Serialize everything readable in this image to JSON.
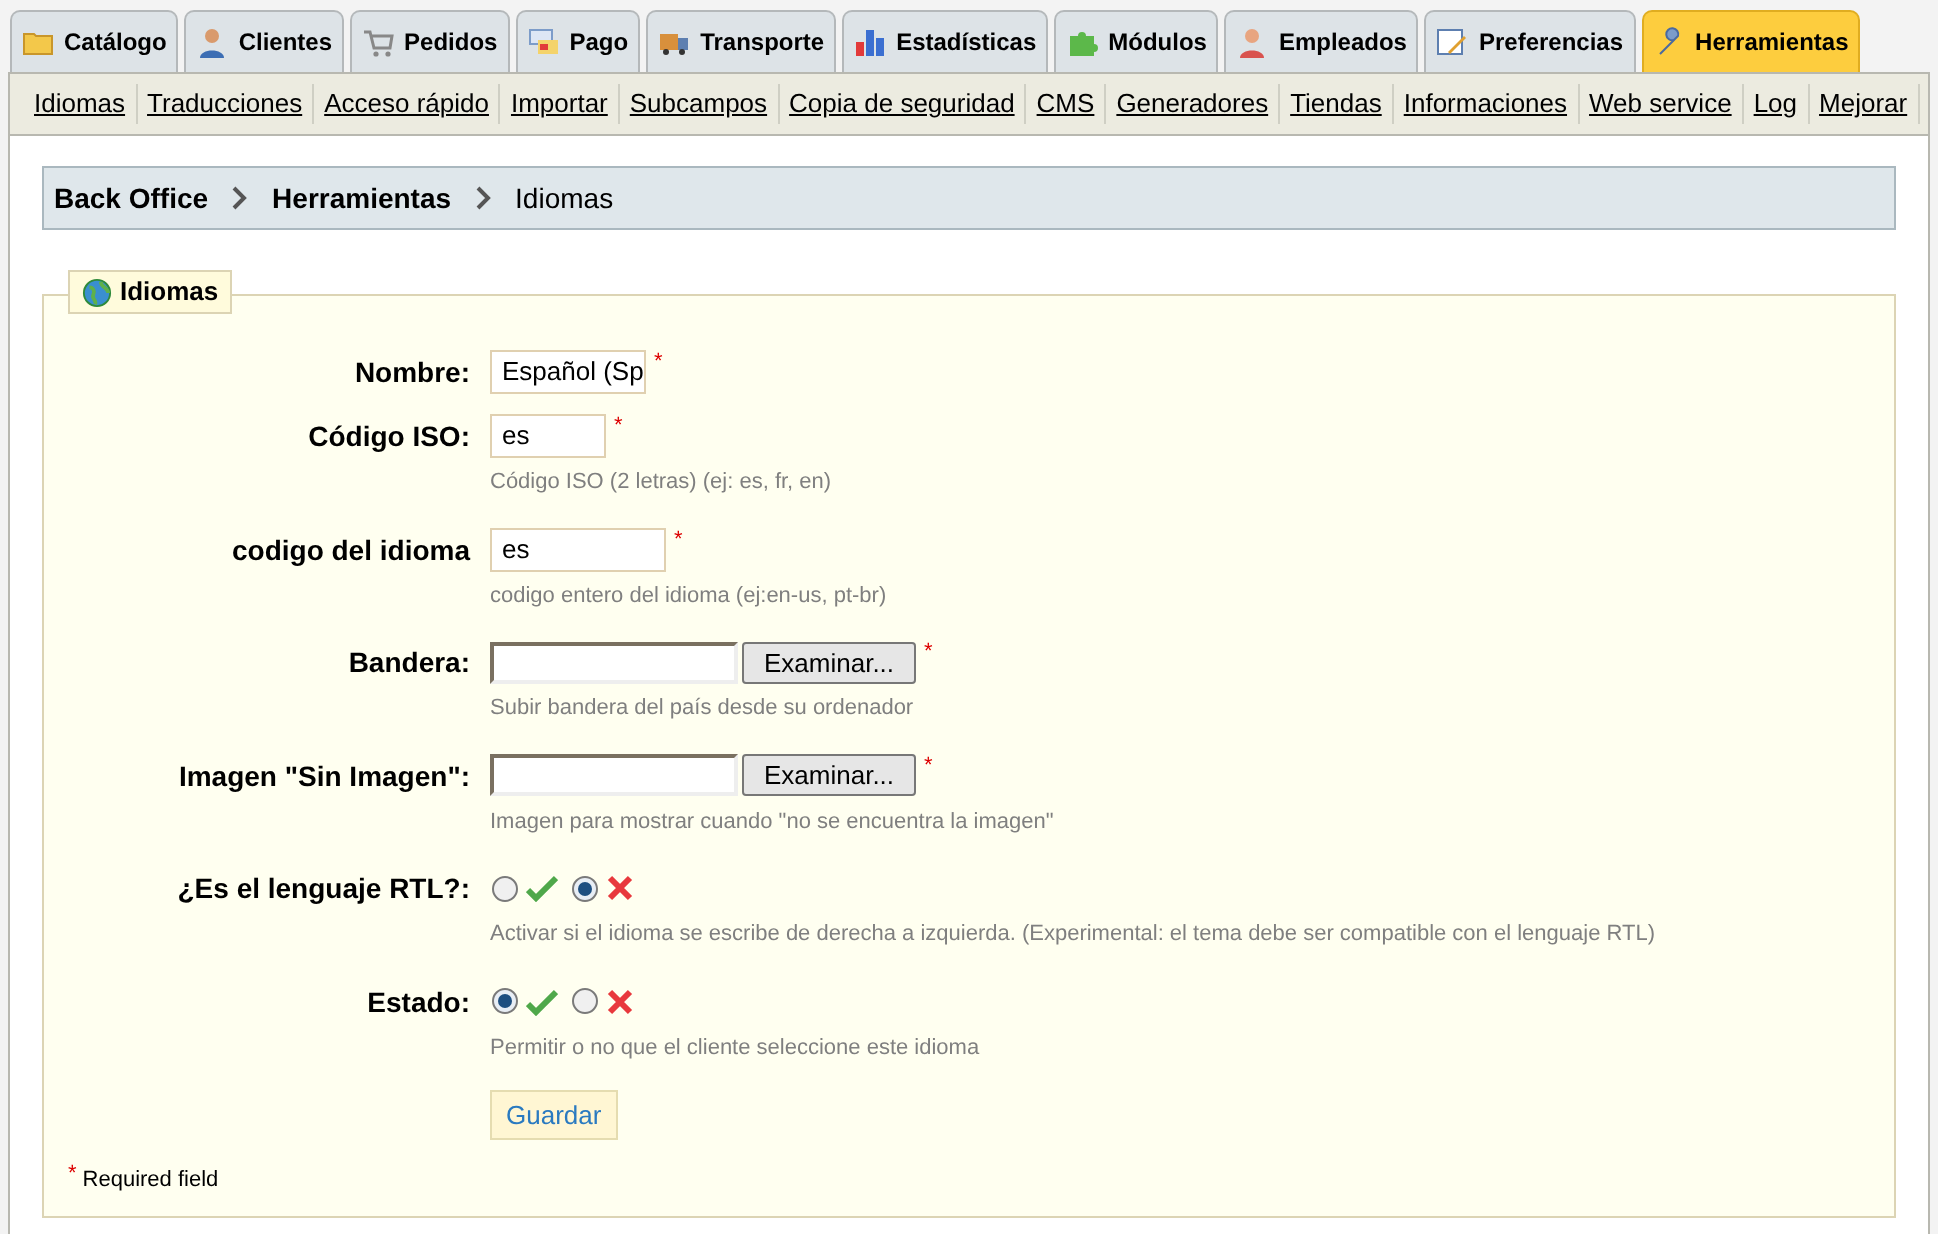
{
  "tabs": [
    {
      "label": "Catálogo",
      "selected": false
    },
    {
      "label": "Clientes",
      "selected": false
    },
    {
      "label": "Pedidos",
      "selected": false
    },
    {
      "label": "Pago",
      "selected": false
    },
    {
      "label": "Transporte",
      "selected": false
    },
    {
      "label": "Estadísticas",
      "selected": false
    },
    {
      "label": "Módulos",
      "selected": false
    },
    {
      "label": "Empleados",
      "selected": false
    },
    {
      "label": "Preferencias",
      "selected": false
    },
    {
      "label": "Herramientas",
      "selected": true
    }
  ],
  "subnav": [
    "Idiomas",
    "Traducciones",
    "Acceso rápido",
    "Importar",
    "Subcampos",
    "Copia de seguridad",
    "CMS",
    "Generadores",
    "Tiendas",
    "Informaciones",
    "Web service",
    "Log",
    "Mejorar"
  ],
  "breadcrumb": [
    "Back Office",
    "Herramientas",
    "Idiomas"
  ],
  "form": {
    "legend": "Idiomas",
    "fields": [
      {
        "kind": "text",
        "label": "Nombre:",
        "value": "Español (Sp",
        "required_mark": "*"
      },
      {
        "kind": "text",
        "label": "Código ISO:",
        "value": "es",
        "required_mark": "*",
        "hint": "Código ISO (2 letras) (ej: es, fr, en)"
      },
      {
        "kind": "text",
        "label": "codigo del idioma",
        "value": "es",
        "required_mark": "*",
        "hint": "codigo entero del idioma (ej:en-us, pt-br)"
      },
      {
        "kind": "file",
        "label": "Bandera:",
        "button": "Examinar...",
        "required_mark": "*",
        "hint": "Subir bandera del país desde su ordenador"
      },
      {
        "kind": "file",
        "label": "Imagen \"Sin Imagen\":",
        "button": "Examinar...",
        "required_mark": "*",
        "hint": "Imagen para mostrar cuando \"no se encuentra la imagen\""
      },
      {
        "kind": "radio",
        "label": "¿Es el lenguaje RTL?:",
        "options": [
          {
            "kind": "yes",
            "selected": false
          },
          {
            "kind": "no",
            "selected": true
          }
        ],
        "hint": "Activar si el idioma se escribe de derecha a izquierda. (Experimental: el tema debe ser compatible con el lenguaje RTL)"
      },
      {
        "kind": "radio",
        "label": "Estado:",
        "options": [
          {
            "kind": "yes",
            "selected": true
          },
          {
            "kind": "no",
            "selected": false
          }
        ],
        "hint": "Permitir o no que el cliente seleccione este idioma"
      }
    ],
    "submit": "Guardar",
    "required_note": {
      "mark": "*",
      "text": "Required field"
    }
  }
}
